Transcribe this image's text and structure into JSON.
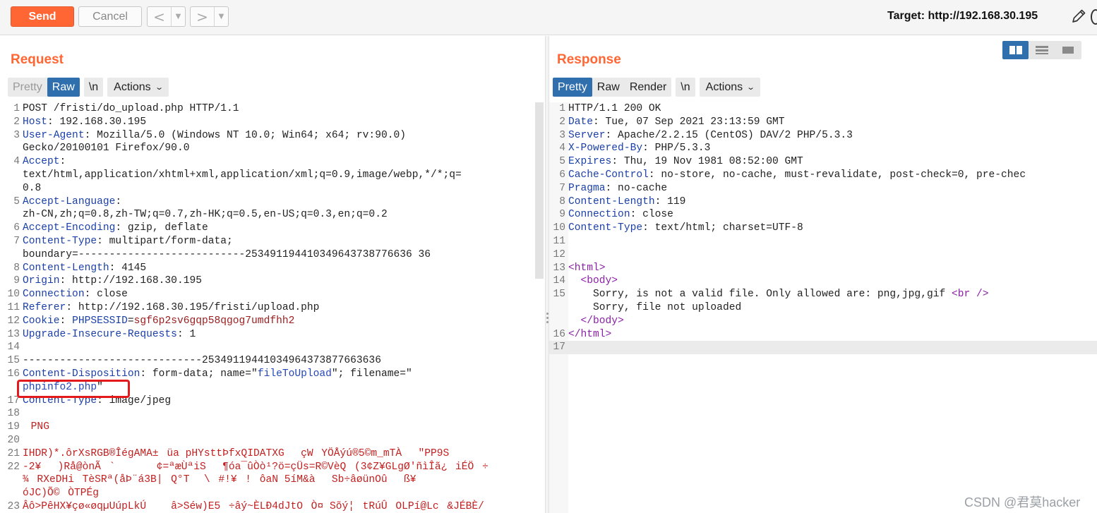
{
  "toolbar": {
    "send_label": "Send",
    "cancel_label": "Cancel",
    "back_arrow": "<",
    "forward_arrow": ">",
    "dropdown_caret": "▼",
    "target_text": "Target: http://192.168.30.195"
  },
  "request": {
    "title": "Request",
    "tabs": [
      "Pretty",
      "Raw",
      "\\n",
      "Actions"
    ],
    "active_tab": "Raw",
    "lines": [
      {
        "n": "1",
        "parts": [
          [
            "c",
            "POST /fristi/do_upload.php HTTP/1.1"
          ]
        ]
      },
      {
        "n": "2",
        "parts": [
          [
            "k",
            "Host"
          ],
          [
            "c",
            ": 192.168.30.195"
          ]
        ]
      },
      {
        "n": "3",
        "parts": [
          [
            "k",
            "User-Agent"
          ],
          [
            "c",
            ": Mozilla/5.0 (Windows NT 10.0; Win64; x64; rv:90.0)"
          ]
        ]
      },
      {
        "n": "",
        "parts": [
          [
            "c",
            "Gecko/20100101 Firefox/90.0"
          ]
        ]
      },
      {
        "n": "4",
        "parts": [
          [
            "k",
            "Accept"
          ],
          [
            "c",
            ":"
          ]
        ]
      },
      {
        "n": "",
        "parts": [
          [
            "c",
            "text/html,application/xhtml+xml,application/xml;q=0.9,image/webp,*/*;q="
          ]
        ]
      },
      {
        "n": "",
        "parts": [
          [
            "c",
            "0.8"
          ]
        ]
      },
      {
        "n": "5",
        "parts": [
          [
            "k",
            "Accept-Language"
          ],
          [
            "c",
            ":"
          ]
        ]
      },
      {
        "n": "",
        "parts": [
          [
            "c",
            "zh-CN,zh;q=0.8,zh-TW;q=0.7,zh-HK;q=0.5,en-US;q=0.3,en;q=0.2"
          ]
        ]
      },
      {
        "n": "6",
        "parts": [
          [
            "k",
            "Accept-Encoding"
          ],
          [
            "c",
            ": gzip, deflate"
          ]
        ]
      },
      {
        "n": "7",
        "parts": [
          [
            "k",
            "Content-Type"
          ],
          [
            "c",
            ": multipart/form-data;"
          ]
        ]
      },
      {
        "n": "",
        "parts": [
          [
            "c",
            "boundary=---------------------------253491194410349643738776636 36"
          ]
        ]
      },
      {
        "n": "8",
        "parts": [
          [
            "k",
            "Content-Length"
          ],
          [
            "c",
            ": 4145"
          ]
        ]
      },
      {
        "n": "9",
        "parts": [
          [
            "k",
            "Origin"
          ],
          [
            "c",
            ": http://192.168.30.195"
          ]
        ]
      },
      {
        "n": "10",
        "parts": [
          [
            "k",
            "Connection"
          ],
          [
            "c",
            ": close"
          ]
        ]
      },
      {
        "n": "11",
        "parts": [
          [
            "k",
            "Referer"
          ],
          [
            "c",
            ": http://192.168.30.195/fristi/upload.php"
          ]
        ]
      },
      {
        "n": "12",
        "parts": [
          [
            "k",
            "Cookie"
          ],
          [
            "c",
            ": "
          ],
          [
            "k",
            "PHPSESSID"
          ],
          [
            "c",
            "="
          ],
          [
            "v",
            "sgf6p2sv6gqp58qgog7umdfhh2"
          ]
        ]
      },
      {
        "n": "13",
        "parts": [
          [
            "k",
            "Upgrade-Insecure-Requests"
          ],
          [
            "c",
            ": 1"
          ]
        ]
      },
      {
        "n": "14",
        "parts": [
          [
            "c",
            ""
          ]
        ]
      },
      {
        "n": "15",
        "parts": [
          [
            "c",
            "-----------------------------25349119441034964373877663636"
          ]
        ]
      },
      {
        "n": "16",
        "parts": [
          [
            "k",
            "Content-Disposition"
          ],
          [
            "c",
            ": form-data; name=\""
          ],
          [
            "s",
            "fileToUpload"
          ],
          [
            "c",
            "\"; filename=\""
          ]
        ]
      },
      {
        "n": "",
        "parts": [
          [
            "s",
            "phpinfo2.php"
          ],
          [
            "c",
            "\""
          ]
        ]
      },
      {
        "n": "17",
        "parts": [
          [
            "k",
            "Content-Type"
          ],
          [
            "c",
            ": image/jpeg"
          ]
        ]
      },
      {
        "n": "18",
        "parts": [
          [
            "c",
            ""
          ]
        ]
      },
      {
        "n": "19",
        "parts": [
          [
            "b",
            "PNG"
          ]
        ]
      },
      {
        "n": "20",
        "parts": [
          [
            "c",
            ""
          ]
        ]
      },
      {
        "n": "21",
        "parts": [
          [
            "b",
            "IHDR)*.ôrXsRGB®ÎégAMA±üa pHYsttÞfxQIDATXGçWYÖÅýú®5©m_mTÀ\"PP9S"
          ]
        ]
      },
      {
        "n": "22",
        "parts": [
          [
            "b",
            "-2¥)Rå@ònÃ`¢=ªæÙªiS¶óa¯ûÒò¹?ö=çÜs=R©VèQ(3¢Z¥GLgØ'ñìÎã¿iÉÖ÷"
          ]
        ]
      },
      {
        "n": "",
        "parts": [
          [
            "b",
            "¾RXeDHiTèSRª(åÞ¨á3B|Q°T \\#!¥!ôaN 5íM&àSb÷âøünOûß¥"
          ]
        ]
      },
      {
        "n": "",
        "parts": [
          [
            "b",
            "óJC)Õ©ÒTPÉg"
          ]
        ]
      },
      {
        "n": "23",
        "parts": [
          [
            "b",
            "Âô>PêHX¥çø«øqµUúpLkÚâ>Séw)E5÷âý~ÈLÐ4dJtOÒ¤ Sõý¦tRúÛOLPí@Lc&JÉBÈ/"
          ]
        ]
      }
    ]
  },
  "response": {
    "title": "Response",
    "tabs": [
      "Pretty",
      "Raw",
      "Render",
      "\\n",
      "Actions"
    ],
    "active_tab": "Pretty",
    "lines": [
      {
        "n": "1",
        "parts": [
          [
            "c",
            "HTTP/1.1 200 OK"
          ]
        ]
      },
      {
        "n": "2",
        "parts": [
          [
            "k",
            "Date"
          ],
          [
            "c",
            ": Tue, 07 Sep 2021 23:13:59 GMT"
          ]
        ]
      },
      {
        "n": "3",
        "parts": [
          [
            "k",
            "Server"
          ],
          [
            "c",
            ": Apache/2.2.15 (CentOS) DAV/2 PHP/5.3.3"
          ]
        ]
      },
      {
        "n": "4",
        "parts": [
          [
            "k",
            "X-Powered-By"
          ],
          [
            "c",
            ": PHP/5.3.3"
          ]
        ]
      },
      {
        "n": "5",
        "parts": [
          [
            "k",
            "Expires"
          ],
          [
            "c",
            ": Thu, 19 Nov 1981 08:52:00 GMT"
          ]
        ]
      },
      {
        "n": "6",
        "parts": [
          [
            "k",
            "Cache-Control"
          ],
          [
            "c",
            ": no-store, no-cache, must-revalidate, post-check=0, pre-chec"
          ]
        ]
      },
      {
        "n": "7",
        "parts": [
          [
            "k",
            "Pragma"
          ],
          [
            "c",
            ": no-cache"
          ]
        ]
      },
      {
        "n": "8",
        "parts": [
          [
            "k",
            "Content-Length"
          ],
          [
            "c",
            ": 119"
          ]
        ]
      },
      {
        "n": "9",
        "parts": [
          [
            "k",
            "Connection"
          ],
          [
            "c",
            ": close"
          ]
        ]
      },
      {
        "n": "10",
        "parts": [
          [
            "k",
            "Content-Type"
          ],
          [
            "c",
            ": text/html; charset=UTF-8"
          ]
        ]
      },
      {
        "n": "11",
        "parts": [
          [
            "c",
            ""
          ]
        ]
      },
      {
        "n": "12",
        "parts": [
          [
            "c",
            ""
          ]
        ]
      },
      {
        "n": "13",
        "parts": [
          [
            "t",
            "<html>"
          ]
        ]
      },
      {
        "n": "14",
        "parts": [
          [
            "c",
            "  "
          ],
          [
            "t",
            "<body>"
          ]
        ]
      },
      {
        "n": "15",
        "parts": [
          [
            "c",
            "    Sorry, is not a valid file. Only allowed are: png,jpg,gif "
          ],
          [
            "t",
            "<br />"
          ]
        ]
      },
      {
        "n": "",
        "parts": [
          [
            "c",
            "    Sorry, file not uploaded"
          ]
        ]
      },
      {
        "n": "",
        "parts": [
          [
            "c",
            "  "
          ],
          [
            "t",
            "</body>"
          ]
        ]
      },
      {
        "n": "16",
        "parts": [
          [
            "t",
            "</html>"
          ]
        ]
      },
      {
        "n": "17",
        "parts": [
          [
            "c",
            ""
          ]
        ],
        "cursor": true
      }
    ]
  },
  "watermark": "CSDN @君莫hacker",
  "icons": {
    "pencil": "pencil-icon",
    "layout_split": "split-columns-icon",
    "layout_rows": "split-rows-icon",
    "layout_single": "single-pane-icon"
  },
  "colors": {
    "accent": "#ff6633",
    "tab_active": "#2f6fae",
    "header_key": "#1a3fa8",
    "cookie_value": "#9b1c1c",
    "html_tag": "#8b1fa8",
    "highlight_box": "#e3191c"
  }
}
